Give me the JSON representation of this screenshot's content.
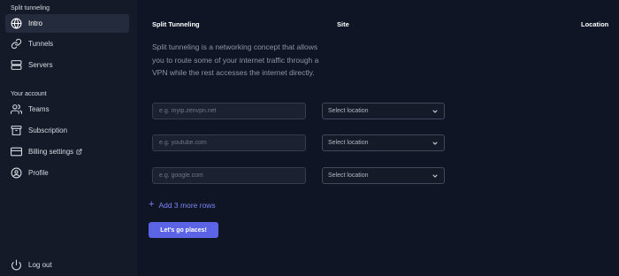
{
  "sidebar": {
    "sections": [
      {
        "label": "Split tunneling",
        "items": [
          {
            "label": "Intro",
            "icon": "globe-icon",
            "active": true
          },
          {
            "label": "Tunnels",
            "icon": "link-icon"
          },
          {
            "label": "Servers",
            "icon": "server-icon"
          }
        ]
      },
      {
        "label": "Your account",
        "items": [
          {
            "label": "Teams",
            "icon": "users-icon"
          },
          {
            "label": "Subscription",
            "icon": "archive-icon"
          },
          {
            "label": "Billing settings",
            "icon": "credit-card-icon",
            "external": true
          },
          {
            "label": "Profile",
            "icon": "user-circle-icon"
          }
        ]
      }
    ],
    "logout": {
      "label": "Log out",
      "icon": "power-icon"
    }
  },
  "main": {
    "headers": {
      "split": "Split Tunneling",
      "site": "Site",
      "location": "Location"
    },
    "intro": "Split tunneling is a networking concept that allows you to route some of your internet traffic through a VPN while the rest accesses the internet directly.",
    "rows": [
      {
        "site_placeholder": "e.g. myip.zenvpn.net",
        "site_value": "",
        "location": "Select location"
      },
      {
        "site_placeholder": "e.g. youtube.com",
        "site_value": "",
        "location": "Select location"
      },
      {
        "site_placeholder": "e.g. google.com",
        "site_value": "",
        "location": "Select location"
      }
    ],
    "add_rows_label": "Add 3 more rows",
    "cta_label": "Let's go places!"
  },
  "colors": {
    "background": "#0f1524",
    "sidebar": "#141a27",
    "active_item": "#232b3d",
    "accent": "#5b63e6",
    "link": "#7c84f5",
    "muted_text": "#8d94a3"
  }
}
